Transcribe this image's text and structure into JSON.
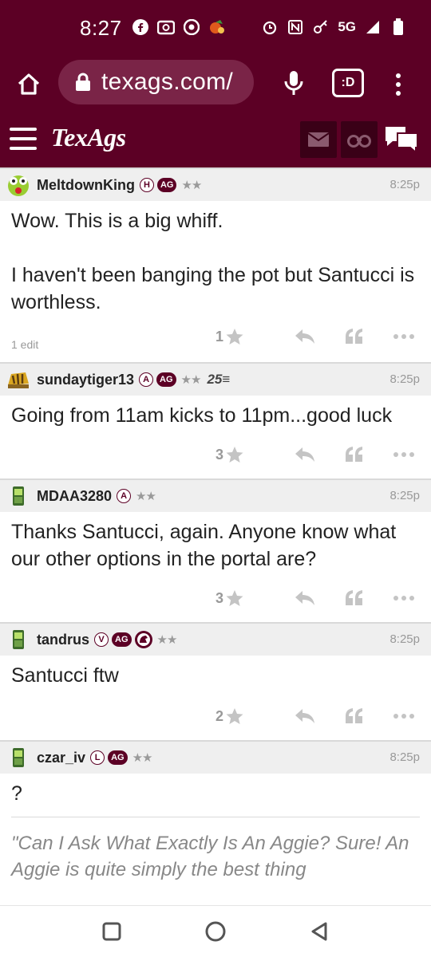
{
  "status_bar": {
    "time": "8:27",
    "left_icons": [
      "facebook-icon",
      "radio-icon",
      "chrome-icon",
      "game-icon"
    ],
    "network": "5G",
    "right_icons": [
      "alarm-icon",
      "nfc-icon",
      "key-icon",
      "data-arrows-icon",
      "signal-icon",
      "battery-icon"
    ]
  },
  "browser": {
    "url": "texags.com/",
    "tab_label": ":D"
  },
  "site": {
    "logo": "TexAgs",
    "colors": {
      "maroon": "#5c0025",
      "maroon_light": "#7a2447",
      "header_dark": "#3a0017"
    }
  },
  "posts": [
    {
      "username": "MeltdownKing",
      "avatar_icon": "frog-face-icon",
      "badges": [
        "H",
        "AG"
      ],
      "stars": "★★",
      "extra": "",
      "time": "8:25p",
      "body": "Wow. This is a big whiff.\n\nI haven't been banging the pot but Santucci is worthless.",
      "edit_note": "1 edit",
      "likes": "1"
    },
    {
      "username": "sundaytiger13",
      "avatar_icon": "tiger-hat-icon",
      "badges": [
        "A",
        "AG"
      ],
      "stars": "★★",
      "extra": "25≡",
      "time": "8:25p",
      "body": "Going from 11am kicks to 11pm...good luck",
      "edit_note": "",
      "likes": "3"
    },
    {
      "username": "MDAA3280",
      "avatar_icon": "phone-icon",
      "badges": [
        "A"
      ],
      "stars": "★★",
      "extra": "",
      "time": "8:25p",
      "body": "Thanks Santucci, again. Anyone know what our other options in the portal are?",
      "edit_note": "",
      "likes": "3"
    },
    {
      "username": "tandrus",
      "avatar_icon": "phone-icon",
      "badges": [
        "V",
        "AG"
      ],
      "emblem": "mascot-emblem-icon",
      "stars": "★★",
      "extra": "",
      "time": "8:25p",
      "body": "Santucci ftw",
      "edit_note": "",
      "likes": "2"
    },
    {
      "username": "czar_iv",
      "avatar_icon": "phone-icon",
      "badges": [
        "L",
        "AG"
      ],
      "stars": "★★",
      "extra": "",
      "time": "8:25p",
      "body": "?",
      "signature": "\"Can I Ask What Exactly Is An Aggie? Sure! An Aggie is quite simply the best thing"
    }
  ],
  "nav": {
    "buttons": [
      "recents-square-icon",
      "home-circle-icon",
      "back-triangle-icon"
    ]
  }
}
